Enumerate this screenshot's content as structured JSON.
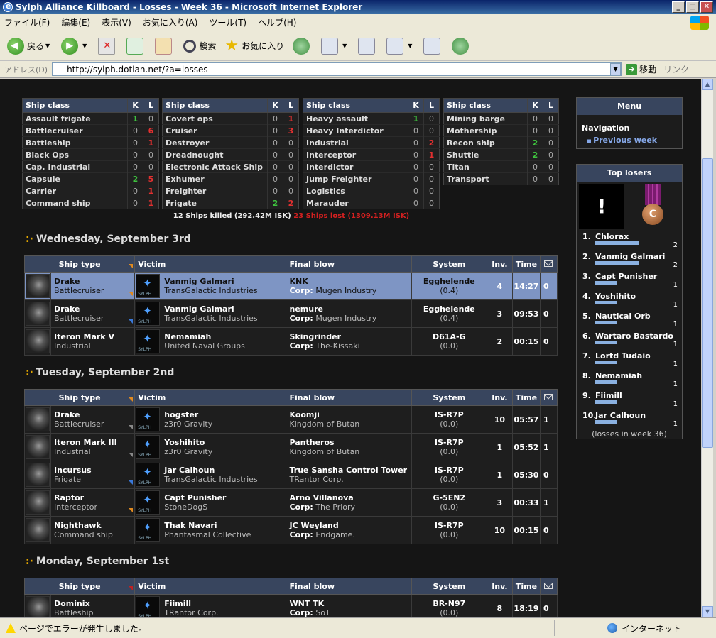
{
  "window": {
    "title": "Sylph Alliance Killboard - Losses - Week 36 - Microsoft Internet Explorer"
  },
  "menu": [
    "ファイル(F)",
    "編集(E)",
    "表示(V)",
    "お気に入り(A)",
    "ツール(T)",
    "ヘルプ(H)"
  ],
  "toolbar": {
    "back": "戻る",
    "search": "検索",
    "favorites": "お気に入り"
  },
  "address": {
    "label": "アドレス(D)",
    "url": "http://sylph.dotlan.net/?a=losses",
    "go": "移動",
    "links": "リンク"
  },
  "classes": {
    "headers": {
      "class": "Ship class",
      "k": "K",
      "l": "L"
    },
    "col1": [
      {
        "name": "Assault frigate",
        "k": "1",
        "l": "0",
        "kc": "g",
        "lc": ""
      },
      {
        "name": "Battlecruiser",
        "k": "0",
        "l": "6",
        "kc": "",
        "lc": "r"
      },
      {
        "name": "Battleship",
        "k": "0",
        "l": "1",
        "kc": "",
        "lc": "r"
      },
      {
        "name": "Black Ops",
        "k": "0",
        "l": "0",
        "kc": "",
        "lc": ""
      },
      {
        "name": "Cap. Industrial",
        "k": "0",
        "l": "0",
        "kc": "",
        "lc": ""
      },
      {
        "name": "Capsule",
        "k": "2",
        "l": "5",
        "kc": "g",
        "lc": "r"
      },
      {
        "name": "Carrier",
        "k": "0",
        "l": "1",
        "kc": "",
        "lc": "r"
      },
      {
        "name": "Command ship",
        "k": "0",
        "l": "1",
        "kc": "",
        "lc": "r"
      }
    ],
    "col2": [
      {
        "name": "Covert ops",
        "k": "0",
        "l": "1",
        "kc": "",
        "lc": "r"
      },
      {
        "name": "Cruiser",
        "k": "0",
        "l": "3",
        "kc": "",
        "lc": "r"
      },
      {
        "name": "Destroyer",
        "k": "0",
        "l": "0",
        "kc": "",
        "lc": ""
      },
      {
        "name": "Dreadnought",
        "k": "0",
        "l": "0",
        "kc": "",
        "lc": ""
      },
      {
        "name": "Electronic Attack Ship",
        "k": "0",
        "l": "0",
        "kc": "",
        "lc": ""
      },
      {
        "name": "Exhumer",
        "k": "0",
        "l": "0",
        "kc": "",
        "lc": ""
      },
      {
        "name": "Freighter",
        "k": "0",
        "l": "0",
        "kc": "",
        "lc": ""
      },
      {
        "name": "Frigate",
        "k": "2",
        "l": "2",
        "kc": "g",
        "lc": "r"
      }
    ],
    "col3": [
      {
        "name": "Heavy assault",
        "k": "1",
        "l": "0",
        "kc": "g",
        "lc": ""
      },
      {
        "name": "Heavy Interdictor",
        "k": "0",
        "l": "0",
        "kc": "",
        "lc": ""
      },
      {
        "name": "Industrial",
        "k": "0",
        "l": "2",
        "kc": "",
        "lc": "r"
      },
      {
        "name": "Interceptor",
        "k": "0",
        "l": "1",
        "kc": "",
        "lc": "r"
      },
      {
        "name": "Interdictor",
        "k": "0",
        "l": "0",
        "kc": "",
        "lc": ""
      },
      {
        "name": "Jump Freighter",
        "k": "0",
        "l": "0",
        "kc": "",
        "lc": ""
      },
      {
        "name": "Logistics",
        "k": "0",
        "l": "0",
        "kc": "",
        "lc": ""
      },
      {
        "name": "Marauder",
        "k": "0",
        "l": "0",
        "kc": "",
        "lc": ""
      }
    ],
    "col4": [
      {
        "name": "Mining barge",
        "k": "0",
        "l": "0",
        "kc": "",
        "lc": ""
      },
      {
        "name": "Mothership",
        "k": "0",
        "l": "0",
        "kc": "",
        "lc": ""
      },
      {
        "name": "Recon ship",
        "k": "2",
        "l": "0",
        "kc": "g",
        "lc": ""
      },
      {
        "name": "Shuttle",
        "k": "2",
        "l": "0",
        "kc": "g",
        "lc": ""
      },
      {
        "name": "Titan",
        "k": "0",
        "l": "0",
        "kc": "",
        "lc": ""
      },
      {
        "name": "Transport",
        "k": "0",
        "l": "0",
        "kc": "",
        "lc": ""
      }
    ]
  },
  "summary": {
    "killed": "12 Ships killed (292.42M ISK)",
    "lost": "23 Ships lost (1309.13M ISK)"
  },
  "loss_headers": {
    "ship": "Ship type",
    "victim": "Victim",
    "final": "Final blow",
    "system": "System",
    "inv": "Inv.",
    "time": "Time"
  },
  "days": [
    {
      "title": "Wednesday, September 3rd",
      "rows": [
        {
          "ship": "Drake",
          "cls": "Battlecruiser",
          "corner": "o",
          "victim": "Vanmig Galmari",
          "vcorp": "TransGalactic Industries",
          "fb": "KNK",
          "fbcorp": "Mugen Industry",
          "corp_prefix": true,
          "sys": "Egghelende",
          "sec": "(0.4)",
          "inv": "4",
          "time": "14:27",
          "cm": "0",
          "hl": true
        },
        {
          "ship": "Drake",
          "cls": "Battlecruiser",
          "corner": "o",
          "victim": "Vanmig Galmari",
          "vcorp": "TransGalactic Industries",
          "fb": "nemure",
          "fbcorp": "Mugen Industry",
          "corp_prefix": true,
          "sys": "Egghelende",
          "sec": "(0.4)",
          "inv": "3",
          "time": "09:53",
          "cm": "0",
          "hl": false
        },
        {
          "ship": "Iteron Mark V",
          "cls": "Industrial",
          "corner": "b",
          "victim": "Nemamiah",
          "vcorp": "United Naval Groups",
          "fb": "Skingrinder",
          "fbcorp": "The-Kissaki",
          "corp_prefix": true,
          "sys": "D61A-G",
          "sec": "(0.0)",
          "inv": "2",
          "time": "00:15",
          "cm": "0",
          "hl": false
        }
      ]
    },
    {
      "title": "Tuesday, September 2nd",
      "rows": [
        {
          "ship": "Drake",
          "cls": "Battlecruiser",
          "corner": "o",
          "victim": "hogster",
          "vcorp": "z3r0 Gravity",
          "fb": "Koomji",
          "fbcorp": "Kingdom of Butan",
          "corp_prefix": false,
          "sys": "IS-R7P",
          "sec": "(0.0)",
          "inv": "10",
          "time": "05:57",
          "cm": "1",
          "hl": false
        },
        {
          "ship": "Iteron Mark III",
          "cls": "Industrial",
          "corner": "gr",
          "victim": "Yoshihito",
          "vcorp": "z3r0 Gravity",
          "fb": "Pantheros",
          "fbcorp": "Kingdom of Butan",
          "corp_prefix": false,
          "sys": "IS-R7P",
          "sec": "(0.0)",
          "inv": "1",
          "time": "05:52",
          "cm": "1",
          "hl": false
        },
        {
          "ship": "Incursus",
          "cls": "Frigate",
          "corner": "gr",
          "victim": "Jar Calhoun",
          "vcorp": "TransGalactic Industries",
          "fb": "True Sansha Control Tower",
          "fbcorp": "TRantor Corp.",
          "corp_prefix": false,
          "sys": "IS-R7P",
          "sec": "(0.0)",
          "inv": "1",
          "time": "05:30",
          "cm": "0",
          "hl": false
        },
        {
          "ship": "Raptor",
          "cls": "Interceptor",
          "corner": "b",
          "victim": "Capt Punisher",
          "vcorp": "StoneDogS",
          "fb": "Arno Villanova",
          "fbcorp": "The Priory",
          "corp_prefix": true,
          "sys": "G-5EN2",
          "sec": "(0.0)",
          "inv": "3",
          "time": "00:33",
          "cm": "1",
          "hl": false
        },
        {
          "ship": "Nighthawk",
          "cls": "Command ship",
          "corner": "o",
          "victim": "Thak Navari",
          "vcorp": "Phantasmal Collective",
          "fb": "JC Weyland",
          "fbcorp": "Endgame.",
          "corp_prefix": true,
          "sys": "IS-R7P",
          "sec": "(0.0)",
          "inv": "10",
          "time": "00:15",
          "cm": "0",
          "hl": false
        }
      ]
    },
    {
      "title": "Monday, September 1st",
      "rows": [
        {
          "ship": "Dominix",
          "cls": "Battleship",
          "corner": "rd",
          "victim": "Fiimill",
          "vcorp": "TRantor Corp.",
          "fb": "WNT TK",
          "fbcorp": "SoT",
          "corp_prefix": true,
          "sys": "BR-N97",
          "sec": "(0.0)",
          "inv": "8",
          "time": "18:19",
          "cm": "0",
          "hl": false
        }
      ]
    }
  ],
  "sidebar": {
    "menu_title": "Menu",
    "nav_label": "Navigation",
    "prev_week": "Previous week",
    "losers_title": "Top losers",
    "medal_letter": "C",
    "blank_mark": "!",
    "losers": [
      {
        "rank": "1.",
        "name": "Chlorax",
        "count": "2",
        "share": 1.0
      },
      {
        "rank": "2.",
        "name": "Vanmig Galmari",
        "count": "2",
        "share": 1.0
      },
      {
        "rank": "3.",
        "name": "Capt Punisher",
        "count": "1",
        "share": 0.5
      },
      {
        "rank": "4.",
        "name": "Yoshihito",
        "count": "1",
        "share": 0.5
      },
      {
        "rank": "5.",
        "name": "Nautical Orb",
        "count": "1",
        "share": 0.5
      },
      {
        "rank": "6.",
        "name": "Wartaro Bastardo",
        "count": "1",
        "share": 0.5
      },
      {
        "rank": "7.",
        "name": "Lortd Tudaio",
        "count": "1",
        "share": 0.5
      },
      {
        "rank": "8.",
        "name": "Nemamiah",
        "count": "1",
        "share": 0.5
      },
      {
        "rank": "9.",
        "name": "Fiimill",
        "count": "1",
        "share": 0.5
      },
      {
        "rank": "10.",
        "name": "Jar Calhoun",
        "count": "1",
        "share": 0.5
      }
    ],
    "losers_foot": "(losses in week 36)"
  },
  "status": {
    "text": "ページでエラーが発生しました。",
    "zone": "インターネット"
  }
}
